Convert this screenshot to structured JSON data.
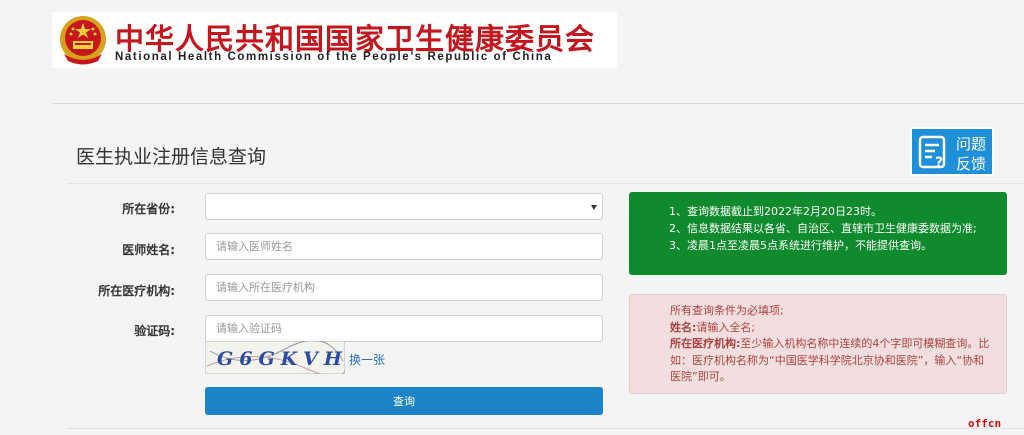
{
  "header": {
    "title_cn": "中华人民共和国国家卫生健康委员会",
    "title_en": "National Health Commission of the People’s Republic of China",
    "brand_red": "#c4161c",
    "emblem_icon": "national-emblem-icon"
  },
  "page": {
    "title": "医生执业注册信息查询"
  },
  "feedback": {
    "line1": "问题",
    "line2": "反馈",
    "icon": "feedback-icon",
    "color": "#1e8fd8"
  },
  "form": {
    "province_label": "所在省份:",
    "province_value": "",
    "name_label": "医师姓名:",
    "name_placeholder": "请输入医师姓名",
    "institution_label": "所在医疗机构:",
    "institution_placeholder": "请输入所在医疗机构",
    "captcha_label": "验证码:",
    "captcha_placeholder": "请输入验证码",
    "captcha_text": "G6GKVH",
    "captcha_refresh": "换一张",
    "submit": "查询"
  },
  "notice_green": {
    "color": "#0f8a2c",
    "lines": [
      "1、查询数据截止到2022年2月20日23时。",
      "2、信息数据结果以各省、自治区、直辖市卫生健康委数据为准;",
      "3、凌晨1点至凌晨5点系统进行维护，不能提供查询。"
    ]
  },
  "notice_red": {
    "intro": "所有查询条件为必填项;",
    "name_key": "姓名:",
    "name_text": "请输入全名;",
    "inst_key": "所在医疗机构:",
    "inst_text": "至少输入机构名称中连续的4个字即可模糊查询。比如：医疗机构名称为“中国医学科学院北京协和医院”，输入“协和医院”即可。"
  },
  "watermark": "offcn"
}
